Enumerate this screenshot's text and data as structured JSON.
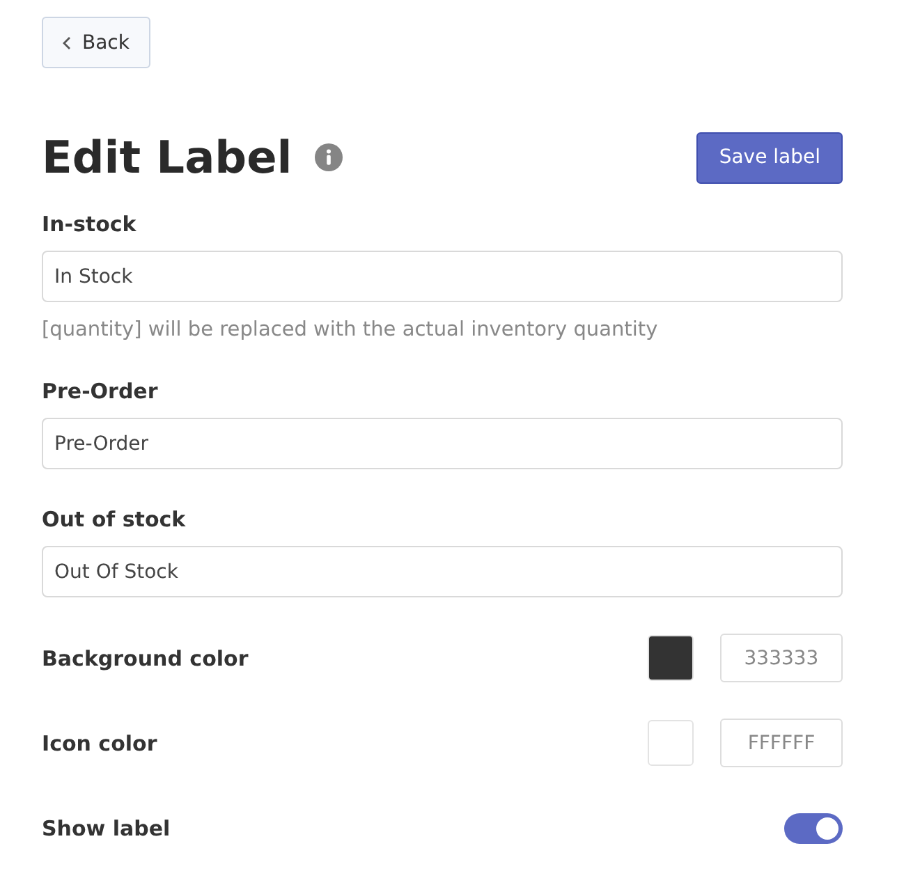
{
  "back_button": "Back",
  "title": "Edit Label",
  "save_button": "Save label",
  "text_fields": [
    {
      "label": "In-stock",
      "value": "In Stock",
      "help": "[quantity] will be replaced with the actual inventory quantity"
    },
    {
      "label": "Pre-Order",
      "value": "Pre-Order"
    },
    {
      "label": "Out of stock",
      "value": "Out Of Stock"
    }
  ],
  "color_fields": [
    {
      "label": "Background color",
      "color": "#333333",
      "value": "333333"
    },
    {
      "label": "Icon color",
      "color": "#ffffff",
      "value": "FFFFFF"
    }
  ],
  "show_label": {
    "label": "Show label",
    "on": true
  }
}
